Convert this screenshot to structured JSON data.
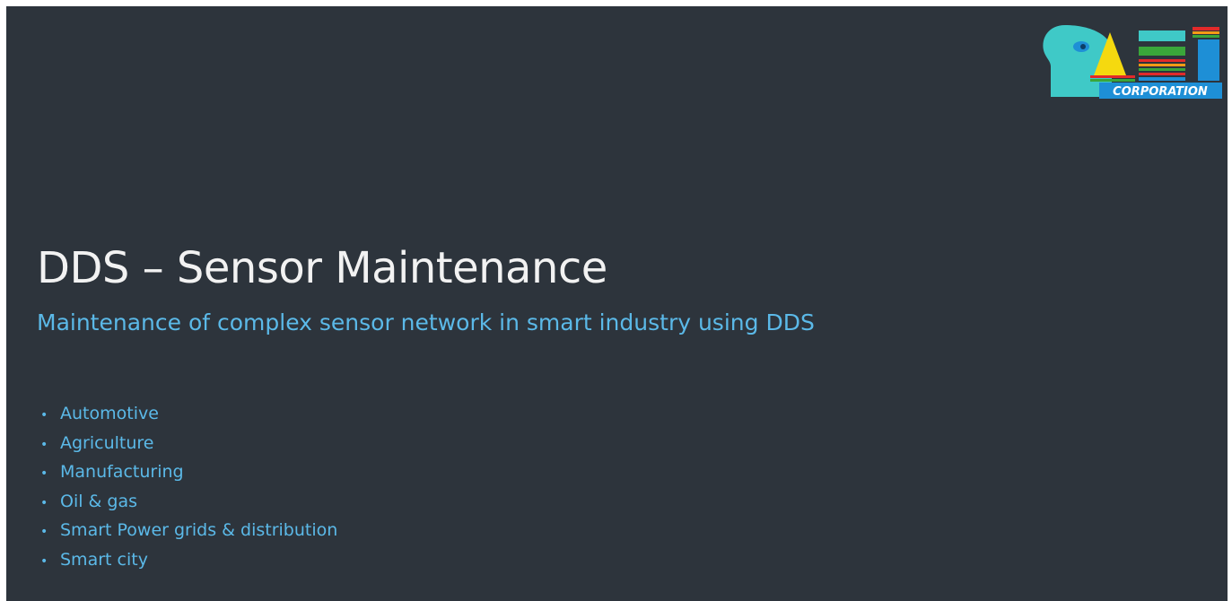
{
  "slide": {
    "title": "DDS – Sensor Maintenance",
    "subtitle": "Maintenance of complex sensor network in smart industry using DDS",
    "bullet_glyph": "•",
    "bullets": [
      "Automotive",
      "Agriculture",
      "Manufacturing",
      "Oil & gas",
      "Smart Power grids & distribution",
      "Smart city"
    ]
  },
  "logo": {
    "text": "CORPORATION",
    "colors": {
      "head": "#3fc9c7",
      "eye": "#1e8fd6",
      "yellow": "#f5d90f",
      "blue": "#1e8fd6",
      "red": "#e22a2a",
      "green": "#3aa63a",
      "orange": "#f59a16",
      "banner": "#1e8fd6"
    }
  },
  "colors": {
    "background": "#2d343c",
    "title_text": "#f2f2f2",
    "accent_text": "#5bb9e8"
  }
}
